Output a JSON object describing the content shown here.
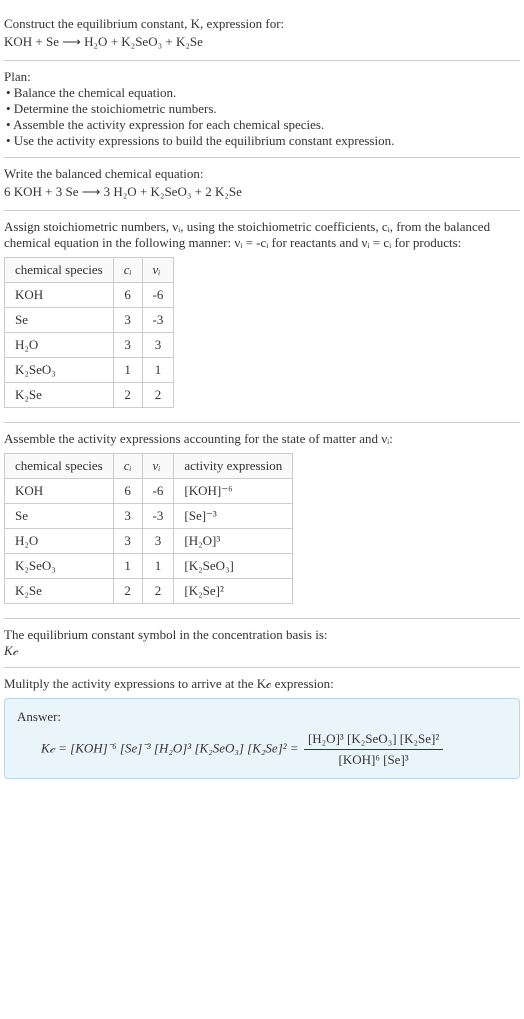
{
  "intro": {
    "line1": "Construct the equilibrium constant, K, expression for:",
    "equation": "KOH + Se  ⟶  H₂O + K₂SeO₃ + K₂Se"
  },
  "plan": {
    "heading": "Plan:",
    "items": [
      "• Balance the chemical equation.",
      "• Determine the stoichiometric numbers.",
      "• Assemble the activity expression for each chemical species.",
      "• Use the activity expressions to build the equilibrium constant expression."
    ]
  },
  "balanced": {
    "heading": "Write the balanced chemical equation:",
    "equation": "6 KOH + 3 Se  ⟶  3 H₂O + K₂SeO₃ + 2 K₂Se"
  },
  "stoich": {
    "text_before": "Assign stoichiometric numbers, νᵢ, using the stoichiometric coefficients, cᵢ, from the balanced chemical equation in the following manner: νᵢ = -cᵢ for reactants and νᵢ = cᵢ for products:",
    "headers": [
      "chemical species",
      "cᵢ",
      "νᵢ"
    ],
    "rows": [
      {
        "species": "KOH",
        "c": "6",
        "v": "-6"
      },
      {
        "species": "Se",
        "c": "3",
        "v": "-3"
      },
      {
        "species": "H₂O",
        "c": "3",
        "v": "3"
      },
      {
        "species": "K₂SeO₃",
        "c": "1",
        "v": "1"
      },
      {
        "species": "K₂Se",
        "c": "2",
        "v": "2"
      }
    ]
  },
  "activity": {
    "heading": "Assemble the activity expressions accounting for the state of matter and νᵢ:",
    "headers": [
      "chemical species",
      "cᵢ",
      "νᵢ",
      "activity expression"
    ],
    "rows": [
      {
        "species": "KOH",
        "c": "6",
        "v": "-6",
        "expr": "[KOH]⁻⁶"
      },
      {
        "species": "Se",
        "c": "3",
        "v": "-3",
        "expr": "[Se]⁻³"
      },
      {
        "species": "H₂O",
        "c": "3",
        "v": "3",
        "expr": "[H₂O]³"
      },
      {
        "species": "K₂SeO₃",
        "c": "1",
        "v": "1",
        "expr": "[K₂SeO₃]"
      },
      {
        "species": "K₂Se",
        "c": "2",
        "v": "2",
        "expr": "[K₂Se]²"
      }
    ]
  },
  "symbol": {
    "line1": "The equilibrium constant symbol in the concentration basis is:",
    "line2": "K𝒸"
  },
  "multiply": {
    "heading": "Mulitply the activity expressions to arrive at the K𝒸 expression:"
  },
  "answer": {
    "label": "Answer:",
    "lhs": "K𝒸 = [KOH]⁻⁶ [Se]⁻³ [H₂O]³ [K₂SeO₃] [K₂Se]² = ",
    "frac_num": "[H₂O]³ [K₂SeO₃] [K₂Se]²",
    "frac_den": "[KOH]⁶ [Se]³"
  }
}
